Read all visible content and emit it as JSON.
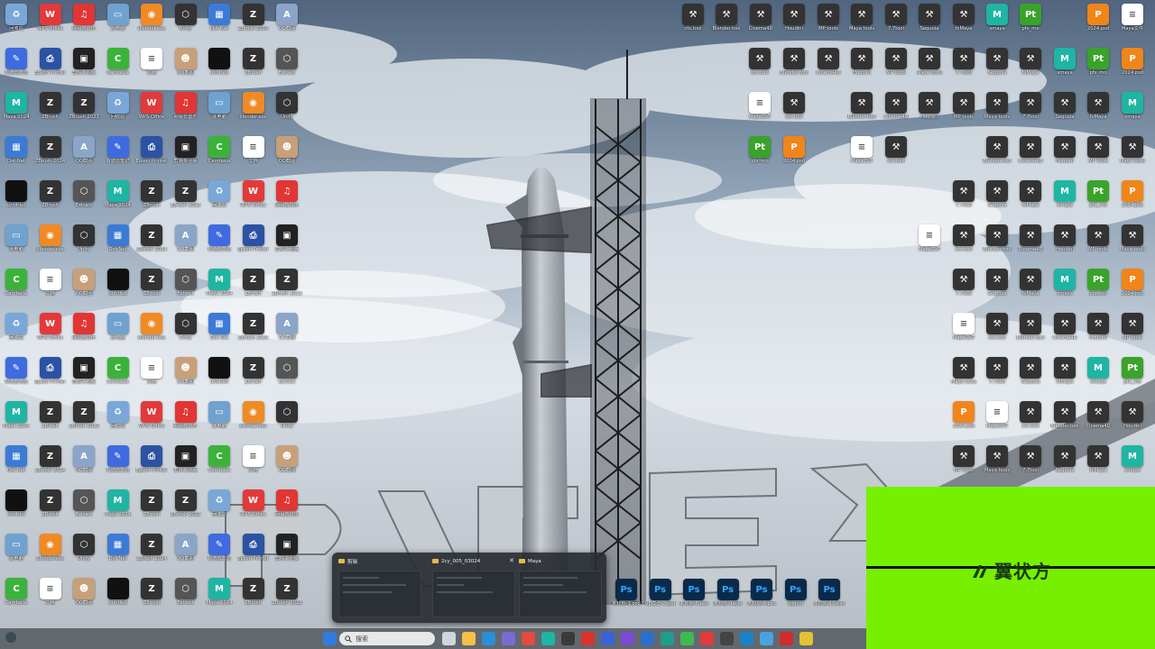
{
  "desktop": {
    "icons_left": [
      {
        "label": "回收站",
        "color": "#7aa7d8",
        "glyph": "♻"
      },
      {
        "label": "WPS Office",
        "color": "#e23a3a",
        "glyph": "W"
      },
      {
        "label": "网易云音乐",
        "color": "#e23535",
        "glyph": "♫"
      },
      {
        "label": "此电脑",
        "color": "#6fa2cf",
        "glyph": "▭"
      },
      {
        "label": "blender.exe",
        "color": "#f08a24",
        "glyph": "◉"
      },
      {
        "label": "Unity",
        "color": "#333333",
        "glyph": "⬡"
      },
      {
        "label": "Dot Net",
        "color": "#3c7bd5",
        "glyph": "▦"
      },
      {
        "label": "ZBrush 2024",
        "color": "#333333",
        "glyph": "Z"
      },
      {
        "label": "QQ截图",
        "color": "#8aa5c8",
        "glyph": "A"
      },
      {
        "label": "有道云笔记",
        "color": "#3f6be0",
        "glyph": "✎"
      },
      {
        "label": "Epson Printer",
        "color": "#2b52a3",
        "glyph": "⎙"
      },
      {
        "label": "剪映专业版",
        "color": "#222222",
        "glyph": "▣"
      },
      {
        "label": "Camtasia",
        "color": "#3bb33b",
        "glyph": "C"
      },
      {
        "label": "文档",
        "color": "#ffffff",
        "glyph": "≡"
      },
      {
        "label": "QQ截图",
        "color": "#c7a07a",
        "glyph": "☻"
      },
      {
        "label": "untitled",
        "color": "#111111",
        "glyph": ""
      },
      {
        "label": "ZBrush",
        "color": "#333333",
        "glyph": "Z"
      },
      {
        "label": "Extract",
        "color": "#555555",
        "glyph": "⬡"
      },
      {
        "label": "Maya 2024",
        "color": "#1fb5a3",
        "glyph": "M"
      },
      {
        "label": "ZBrush",
        "color": "#333333",
        "glyph": "Z"
      },
      {
        "label": "ZBrush 2023",
        "color": "#333333",
        "glyph": "Z"
      }
    ],
    "icons_right": [
      {
        "label": "cfx.tool",
        "color": "#333333",
        "glyph": "⚒"
      },
      {
        "label": "Blender.tool",
        "color": "#333333",
        "glyph": "⚒"
      },
      {
        "label": "Cinema4D",
        "color": "#333333",
        "glyph": "⚒"
      },
      {
        "label": "Houdini",
        "color": "#333333",
        "glyph": "⚒"
      },
      {
        "label": "MP tools",
        "color": "#333333",
        "glyph": "⚒"
      },
      {
        "label": "Maya tools",
        "color": "#333333",
        "glyph": "⚒"
      },
      {
        "label": "7.7tool",
        "color": "#333333",
        "glyph": "⚒"
      },
      {
        "label": "Sequoia",
        "color": "#333333",
        "glyph": "⚒"
      },
      {
        "label": "fxMaya",
        "color": "#333333",
        "glyph": "⚒"
      },
      {
        "label": "xmaya",
        "color": "#1fb5a3",
        "glyph": "M"
      },
      {
        "label": "pfx_mo",
        "color": "#3aa32a",
        "glyph": "Pt"
      },
      {
        "label": "2024.psd",
        "color": "#f0851a",
        "glyph": "P"
      },
      {
        "label": "Maya文件",
        "color": "#ffffff",
        "glyph": "≡"
      }
    ]
  },
  "preview": {
    "items": [
      {
        "title": "剪辑"
      },
      {
        "title": "2cy_005_03024"
      },
      {
        "title": "Maya"
      }
    ]
  },
  "psd_files": [
    {
      "label": "未标题-1.psd"
    },
    {
      "label": "UE模型-2.psd"
    },
    {
      "label": "未标题-5.psd"
    },
    {
      "label": "未标题-9.psd"
    },
    {
      "label": "未标题-8.psd"
    },
    {
      "label": "xg.psd"
    },
    {
      "label": "未标题-10.psd"
    }
  ],
  "overlay": {
    "brand": "翼状方",
    "color": "#76f000"
  },
  "taskbar": {
    "search_placeholder": "搜索",
    "apps": [
      {
        "name": "windows-start-icon",
        "color": "#2f7de1"
      },
      {
        "name": "task-view-icon",
        "color": "#cfd6de"
      },
      {
        "name": "file-explorer-icon",
        "color": "#f4c24a"
      },
      {
        "name": "edge-icon",
        "color": "#2a8fd8"
      },
      {
        "name": "photos-icon",
        "color": "#7a6bd3"
      },
      {
        "name": "chrome-icon",
        "color": "#e24c3c"
      },
      {
        "name": "maya-icon",
        "color": "#1fb5a3"
      },
      {
        "name": "terminal-icon",
        "color": "#3a3a3a"
      },
      {
        "name": "app-red-icon",
        "color": "#d8342c"
      },
      {
        "name": "app-blue-icon",
        "color": "#3a62d9"
      },
      {
        "name": "vs-icon",
        "color": "#7b4bd1"
      },
      {
        "name": "outlook-icon",
        "color": "#2a6fd0"
      },
      {
        "name": "app-teal-icon",
        "color": "#1e9e8a"
      },
      {
        "name": "wechat-icon",
        "color": "#3dbb4f"
      },
      {
        "name": "wps-icon",
        "color": "#e23a3a"
      },
      {
        "name": "unity-icon",
        "color": "#444444"
      },
      {
        "name": "photoshop-icon",
        "color": "#1b82c8"
      },
      {
        "name": "qq-icon",
        "color": "#4aa3df"
      },
      {
        "name": "netease-icon",
        "color": "#d32a2a"
      },
      {
        "name": "app-yellow-icon",
        "color": "#e2c331"
      }
    ]
  }
}
